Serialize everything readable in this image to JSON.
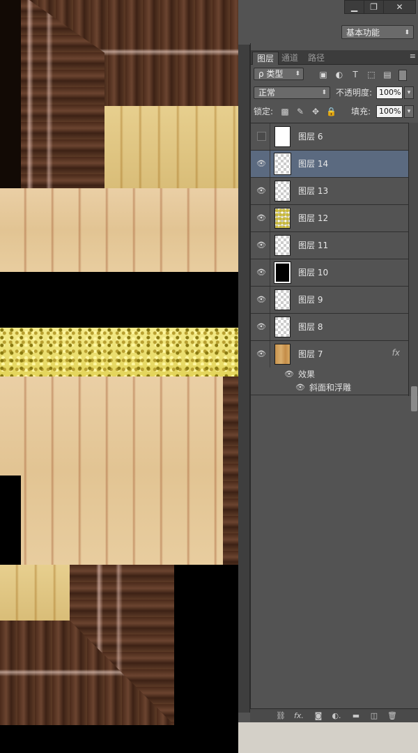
{
  "window": {
    "minimize_glyph": "▁",
    "restore_glyph": "❐",
    "close_glyph": "✕"
  },
  "workspace": {
    "label": "基本功能"
  },
  "panel": {
    "tabs": [
      {
        "label": "图层"
      },
      {
        "label": "通道"
      },
      {
        "label": "路径"
      }
    ],
    "menu_glyph": "≡"
  },
  "filter": {
    "label": "ρ 类型"
  },
  "blend": {
    "mode": "正常",
    "opacity_label": "不透明度:",
    "opacity": "100%"
  },
  "lock": {
    "label": "锁定:",
    "fill_label": "填充:",
    "fill": "100%"
  },
  "layers": [
    {
      "name": "图层 6",
      "visible": false,
      "thumb": "white"
    },
    {
      "name": "图层 14",
      "visible": true,
      "thumb": "checker",
      "selected": true
    },
    {
      "name": "图层 13",
      "visible": true,
      "thumb": "checker"
    },
    {
      "name": "图层 12",
      "visible": true,
      "thumb": "yellowish"
    },
    {
      "name": "图层 11",
      "visible": true,
      "thumb": "checker"
    },
    {
      "name": "图层 10",
      "visible": true,
      "thumb": "black"
    },
    {
      "name": "图层 9",
      "visible": true,
      "thumb": "checker"
    },
    {
      "name": "图层 8",
      "visible": true,
      "thumb": "checker"
    },
    {
      "name": "图层 7",
      "visible": true,
      "thumb": "wood",
      "fx": "fx"
    }
  ],
  "effects": {
    "label": "效果",
    "items": [
      "斜面和浮雕"
    ]
  },
  "bottom_icons": [
    "link-icon",
    "fx-icon",
    "mask-icon",
    "adjustment-icon",
    "folder-icon",
    "new-layer-icon",
    "trash-icon"
  ]
}
